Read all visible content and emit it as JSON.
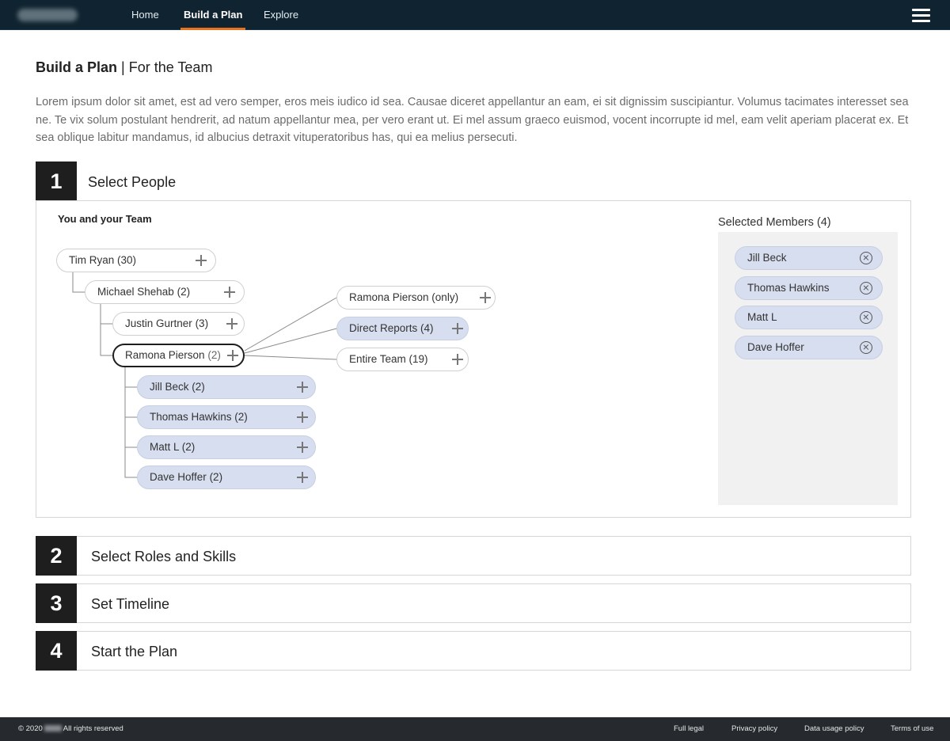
{
  "nav": {
    "items": [
      {
        "label": "Home"
      },
      {
        "label": "Build a Plan",
        "active": true
      },
      {
        "label": "Explore"
      }
    ],
    "accent_color": "#e8731e"
  },
  "page": {
    "title_bold": "Build a Plan",
    "title_rest": "| For the Team",
    "intro": "Lorem ipsum dolor sit amet, est ad vero semper, eros meis iudico id sea. Causae diceret appellantur an eam, ei sit dignissim suscipiantur. Volumus tacimates interesset sea ne. Te vix solum postulant hendrerit, ad natum appellantur mea, per vero erant ut. Ei mel assum graeco euismod, vocent incorrupte id mel, eam velit aperiam placerat ex. Et sea oblique labitur mandamus, id albucius detraxit vituperatoribus has, qui ea melius persecuti."
  },
  "steps": [
    {
      "number": "1",
      "title": "Select People"
    },
    {
      "number": "2",
      "title": "Select Roles and Skills"
    },
    {
      "number": "3",
      "title": "Set Timeline"
    },
    {
      "number": "4",
      "title": "Start the Plan"
    }
  ],
  "team": {
    "label": "You and your Team",
    "tree": [
      {
        "name": "Tim Ryan",
        "count": "(30)"
      },
      {
        "name": "Michael Shehab",
        "count": "(2)"
      },
      {
        "name": "Justin Gurtner",
        "count": "(3)"
      },
      {
        "name": "Ramona Pierson",
        "count": "(2)",
        "focused": true
      },
      {
        "name": "Jill Beck",
        "count": "(2)",
        "selected": true
      },
      {
        "name": "Thomas Hawkins",
        "count": "(2)",
        "selected": true
      },
      {
        "name": "Matt L",
        "count": "(2)",
        "selected": true
      },
      {
        "name": "Dave Hoffer",
        "count": "(2)",
        "selected": true
      }
    ],
    "options": [
      {
        "label": "Ramona Pierson (only)"
      },
      {
        "label": "Direct Reports (4)",
        "selected": true
      },
      {
        "label": "Entire Team (19)"
      }
    ]
  },
  "selected": {
    "title": "Selected Members (4)",
    "members": [
      "Jill Beck",
      "Thomas Hawkins",
      "Matt L",
      "Dave Hoffer"
    ]
  },
  "footer": {
    "copyright_prefix": "© 2020",
    "copyright_suffix": "All rights reserved",
    "links": [
      "Full legal",
      "Privacy policy",
      "Data usage policy",
      "Terms of use"
    ]
  }
}
